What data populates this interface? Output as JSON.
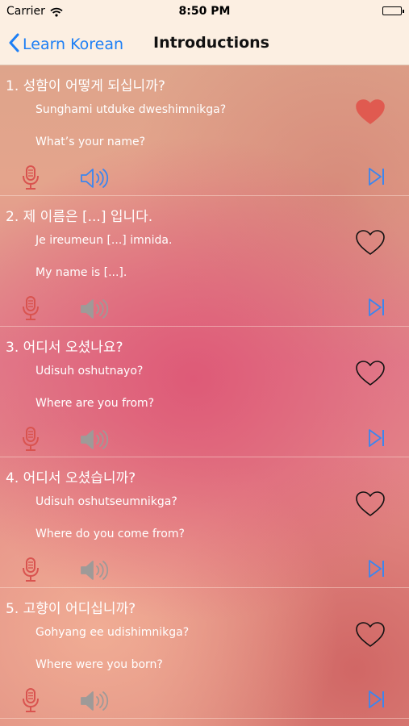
{
  "status": {
    "carrier": "Carrier",
    "time": "8:50 PM"
  },
  "nav": {
    "back_label": "Learn Korean",
    "title": "Introductions"
  },
  "colors": {
    "heart_filled": "#e05a50",
    "icon_red": "#d9534f",
    "icon_blue": "#3a86f0",
    "icon_gray": "#9e9a98",
    "nav_bg": "#fcefe2"
  },
  "phrases": [
    {
      "korean": "1. 성함이 어떻게 되십니까?",
      "romanization": "Sunghami utduke dweshimnikga?",
      "english": "What’s your name?",
      "favorite": true,
      "speaker_active": true
    },
    {
      "korean": "2. 제 이름은 [...] 입니다.",
      "romanization": "Je ireumeun [...] imnida.",
      "english": "My name is [...].",
      "favorite": false,
      "speaker_active": false
    },
    {
      "korean": "3. 어디서 오셨나요?",
      "romanization": "Udisuh oshutnayo?",
      "english": "Where are you from?",
      "favorite": false,
      "speaker_active": false
    },
    {
      "korean": "4. 어디서 오셨습니까?",
      "romanization": "Udisuh oshutseumnikga?",
      "english": "Where do you come from?",
      "favorite": false,
      "speaker_active": false
    },
    {
      "korean": "5. 고향이 어디십니까?",
      "romanization": "Gohyang ee udishimnikga?",
      "english": "Where were you born?",
      "favorite": false,
      "speaker_active": false
    }
  ]
}
